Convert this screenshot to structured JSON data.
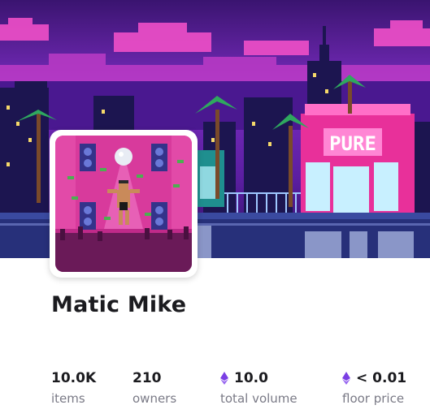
{
  "collection": {
    "name": "Matic Mike",
    "banner_sign": "PURE",
    "colors": {
      "accent": "#7b3fe4",
      "sky": "#6b1fa8",
      "pink": "#e8309a"
    }
  },
  "stats": [
    {
      "value": "10.0K",
      "label": "items",
      "icon": ""
    },
    {
      "value": "210",
      "label": "owners",
      "icon": ""
    },
    {
      "value": "10.0",
      "label": "total volume",
      "icon": "eth-icon"
    },
    {
      "value": "< 0.01",
      "label": "floor price",
      "icon": "eth-icon"
    }
  ]
}
